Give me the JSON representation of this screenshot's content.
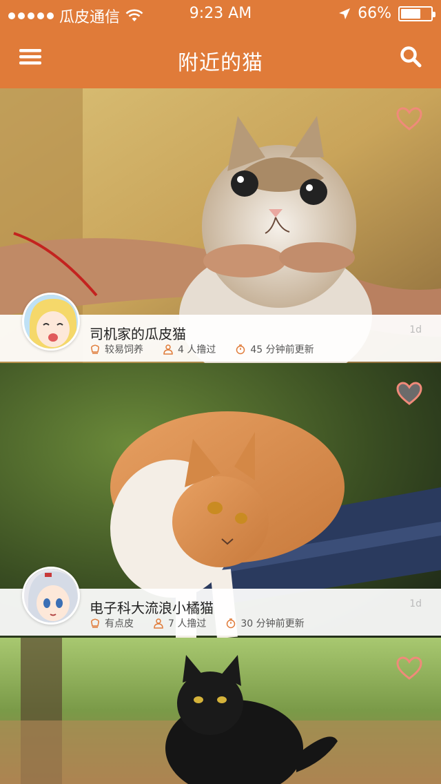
{
  "status_bar": {
    "carrier": "瓜皮通信",
    "time": "9:23 AM",
    "battery": "66%",
    "battery_level": 0.66
  },
  "nav": {
    "title": "附近的猫",
    "menu_icon": "hamburger-menu-icon",
    "search_icon": "search-icon"
  },
  "colors": {
    "brand": "#e07b39",
    "heart_outline": "#f08a7a",
    "heart_filled": "#f08a7a"
  },
  "cards": [
    {
      "title": "司机家的瓜皮猫",
      "age": "1d",
      "temperament": "较易饲养",
      "petted": "4 人撸过",
      "updated": "45 分钟前更新",
      "favorited": false
    },
    {
      "title": "电子科大流浪小橘猫",
      "age": "1d",
      "temperament": "有点皮",
      "petted": "7 人撸过",
      "updated": "30 分钟前更新",
      "favorited": true
    },
    {
      "favorited": false
    }
  ]
}
